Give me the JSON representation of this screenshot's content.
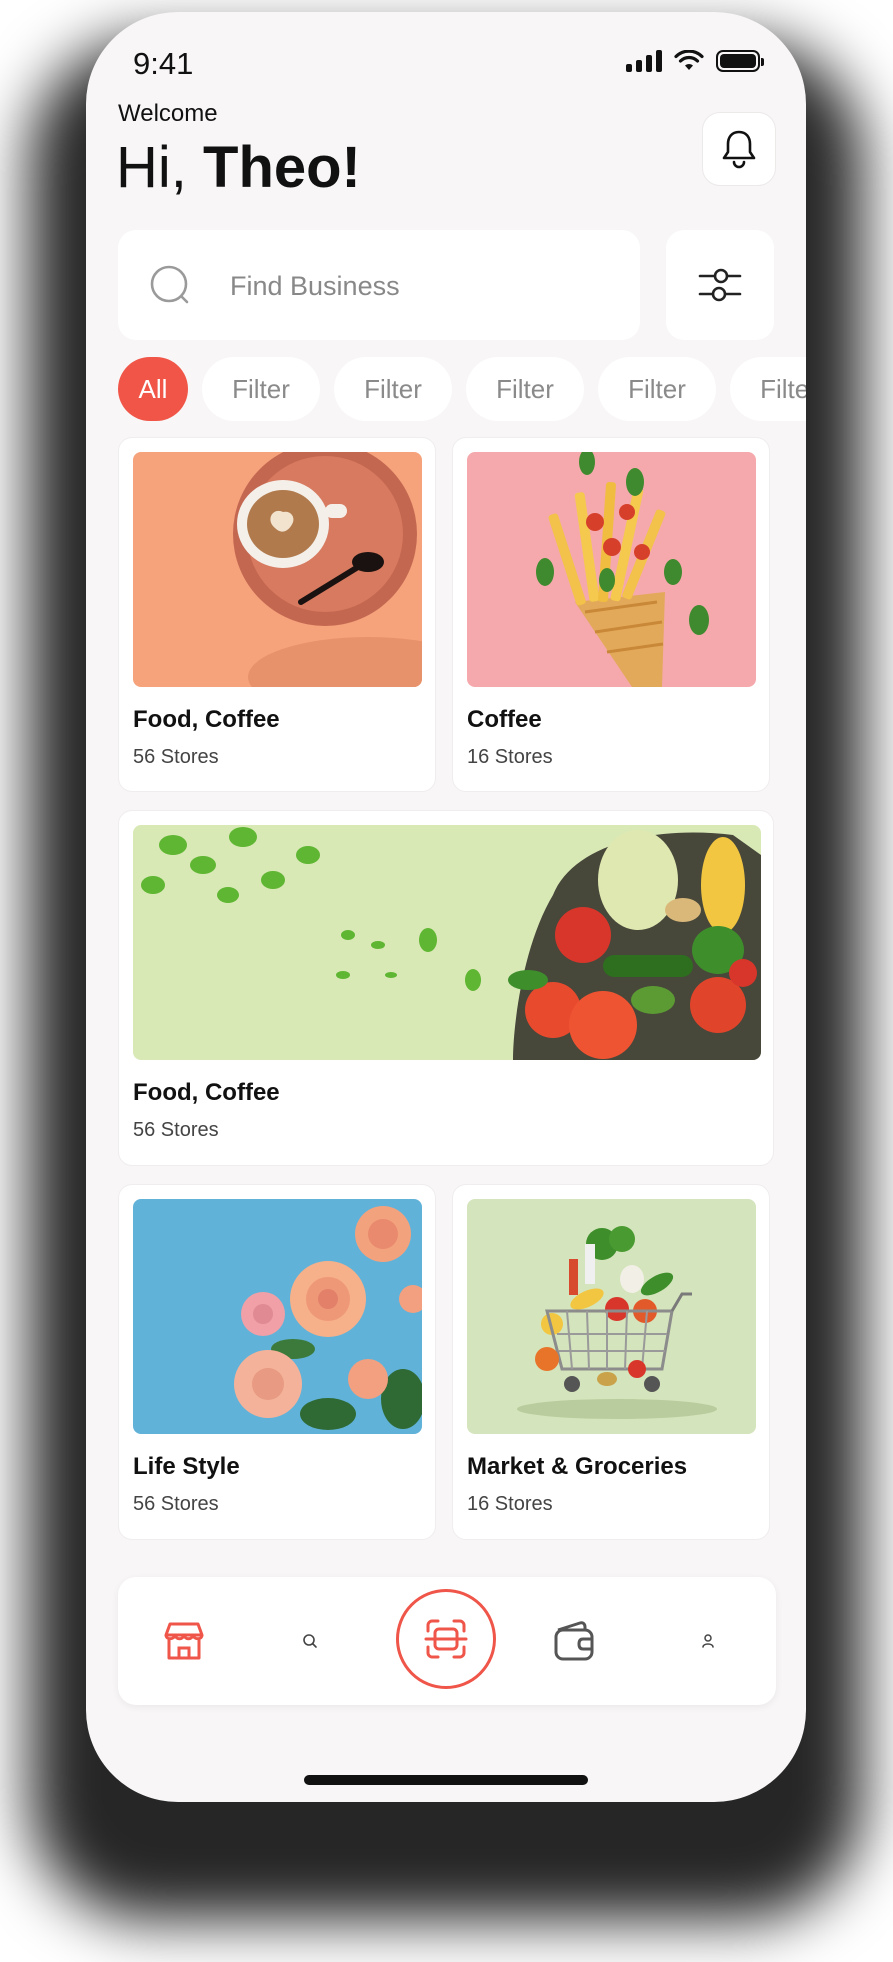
{
  "status_bar": {
    "time": "9:41"
  },
  "header": {
    "welcome": "Welcome",
    "greeting_prefix": "Hi,",
    "user_name": "Theo!"
  },
  "search": {
    "placeholder": "Find Business"
  },
  "filters": {
    "chips": [
      "All",
      "Filter",
      "Filter",
      "Filter",
      "Filter",
      "Filter"
    ],
    "active_index": 0
  },
  "categories": [
    {
      "title": "Food, Coffee",
      "subtitle": "56 Stores",
      "image": "coffee-cup-photo"
    },
    {
      "title": "Coffee",
      "subtitle": "16 Stores",
      "image": "fries-cone-photo"
    },
    {
      "title": "Food, Coffee",
      "subtitle": "56 Stores",
      "image": "vegetables-banner-photo"
    },
    {
      "title": "Life Style",
      "subtitle": "56 Stores",
      "image": "roses-photo"
    },
    {
      "title": "Market & Groceries",
      "subtitle": "16 Stores",
      "image": "grocery-cart-photo"
    }
  ],
  "bottom_nav": {
    "items": [
      "store-icon",
      "search-icon",
      "scan-icon",
      "wallet-icon",
      "user-icon"
    ],
    "active": "store-icon"
  },
  "colors": {
    "accent": "#f05548",
    "background": "#f8f6f6",
    "card": "#ffffff",
    "text_primary": "#111111",
    "text_muted": "#8a8a8a"
  }
}
